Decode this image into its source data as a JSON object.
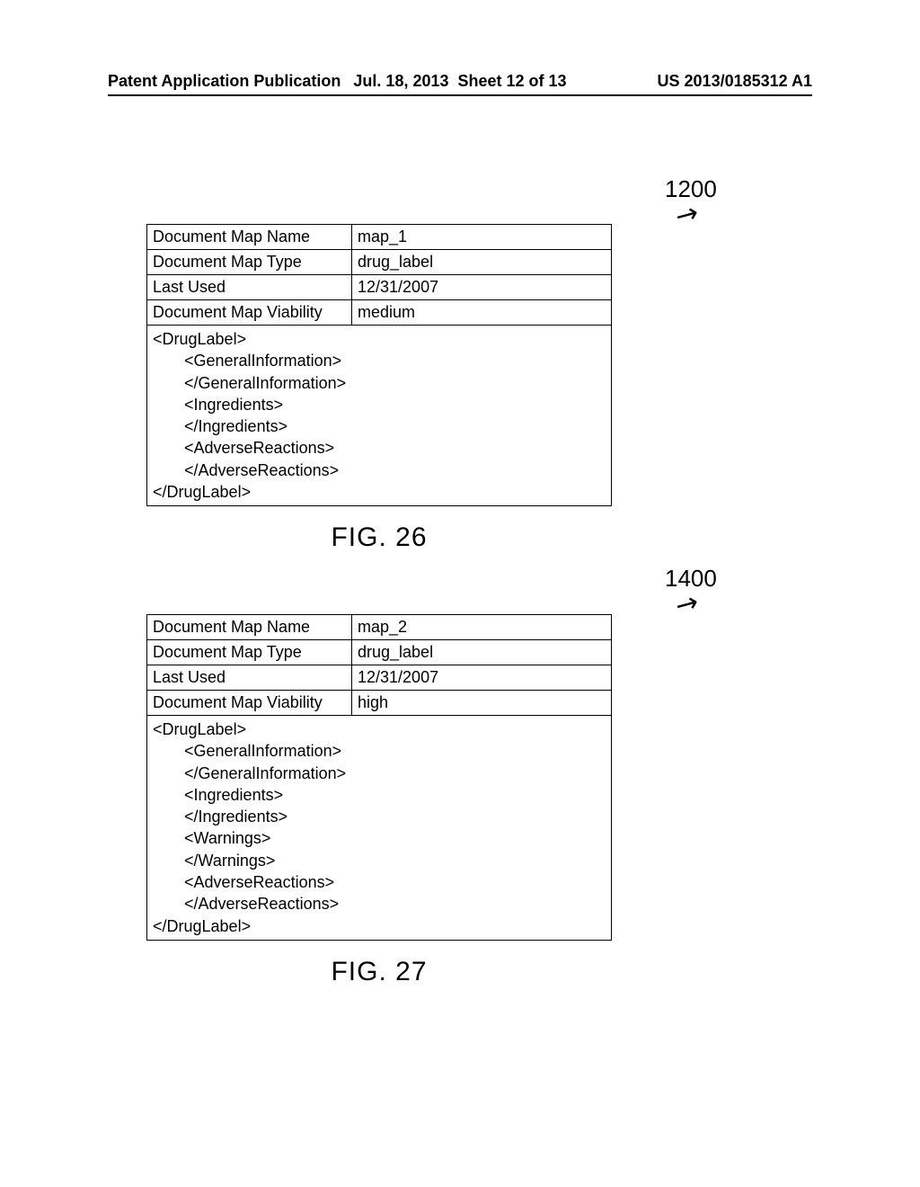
{
  "header": {
    "left": "Patent Application Publication",
    "date": "Jul. 18, 2013",
    "sheet": "Sheet 12 of 13",
    "pubno": "US 2013/0185312 A1"
  },
  "fig26": {
    "ref": "1200",
    "rows": [
      {
        "k": "Document Map Name",
        "v": "map_1"
      },
      {
        "k": "Document Map Type",
        "v": "drug_label"
      },
      {
        "k": "Last Used",
        "v": "12/31/2007"
      },
      {
        "k": "Document Map Viability",
        "v": "medium"
      }
    ],
    "xml": "<DrugLabel>\n       <GeneralInformation>\n       </GeneralInformation>\n       <Ingredients>\n       </Ingredients>\n       <AdverseReactions>\n       </AdverseReactions>\n</DrugLabel>",
    "caption": "FIG. 26"
  },
  "fig27": {
    "ref": "1400",
    "rows": [
      {
        "k": "Document Map Name",
        "v": "map_2"
      },
      {
        "k": "Document Map Type",
        "v": "drug_label"
      },
      {
        "k": "Last Used",
        "v": "12/31/2007"
      },
      {
        "k": "Document Map Viability",
        "v": "high"
      }
    ],
    "xml": "<DrugLabel>\n       <GeneralInformation>\n       </GeneralInformation>\n       <Ingredients>\n       </Ingredients>\n       <Warnings>\n       </Warnings>\n       <AdverseReactions>\n       </AdverseReactions>\n</DrugLabel>",
    "caption": "FIG. 27"
  }
}
